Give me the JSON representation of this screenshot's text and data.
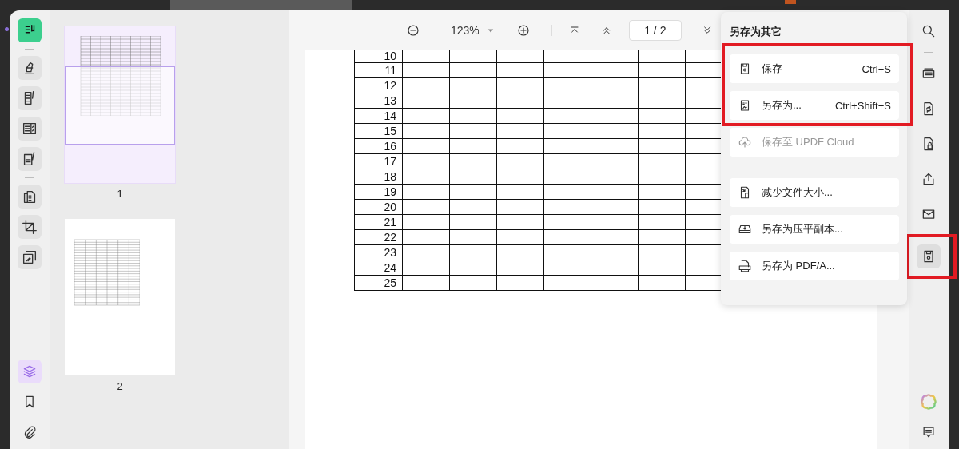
{
  "left_toolbar": {
    "top_tools": [
      {
        "selected": true
      },
      {
        "selected": false
      },
      {
        "selected": false
      },
      {
        "selected": false
      },
      {
        "selected": false
      },
      {
        "selected": false
      },
      {
        "selected": false
      },
      {
        "selected": false
      }
    ],
    "bottom_tools": [
      {
        "selected": true
      },
      {
        "selected": false
      },
      {
        "selected": false
      }
    ]
  },
  "thumbnails": [
    {
      "label": "1",
      "selected": true
    },
    {
      "label": "2",
      "selected": false
    }
  ],
  "toolbar": {
    "zoom": "123%",
    "page_field": "1 / 2"
  },
  "document": {
    "row_numbers": [
      "10",
      "11",
      "12",
      "13",
      "14",
      "15",
      "16",
      "17",
      "18",
      "19",
      "20",
      "21",
      "22",
      "23",
      "24",
      "25"
    ]
  },
  "menu": {
    "title": "另存为其它",
    "groups": [
      {
        "highlighted": true,
        "items": [
          {
            "label": "保存",
            "shortcut": "Ctrl+S",
            "disabled": false
          },
          {
            "label": "另存为...",
            "shortcut": "Ctrl+Shift+S",
            "disabled": false
          }
        ]
      },
      {
        "highlighted": false,
        "items": [
          {
            "label": "保存至 UPDF Cloud",
            "disabled": true
          }
        ]
      },
      {
        "highlighted": false,
        "items": [
          {
            "label": "减少文件大小...",
            "disabled": false
          },
          {
            "label": "另存为压平副本...",
            "disabled": false
          },
          {
            "label": "另存为 PDF/A...",
            "disabled": false
          }
        ]
      }
    ]
  },
  "right_toolbar": {
    "top_tools": [
      {
        "selected": false,
        "highlighted": false
      },
      {
        "selected": false,
        "highlighted": false
      },
      {
        "selected": false,
        "highlighted": false
      },
      {
        "selected": false,
        "highlighted": false
      },
      {
        "selected": false,
        "highlighted": false
      },
      {
        "selected": false,
        "highlighted": false
      },
      {
        "selected": true,
        "highlighted": true
      }
    ],
    "bottom_tools": [
      {
        "selected": false
      },
      {
        "selected": false
      }
    ]
  }
}
